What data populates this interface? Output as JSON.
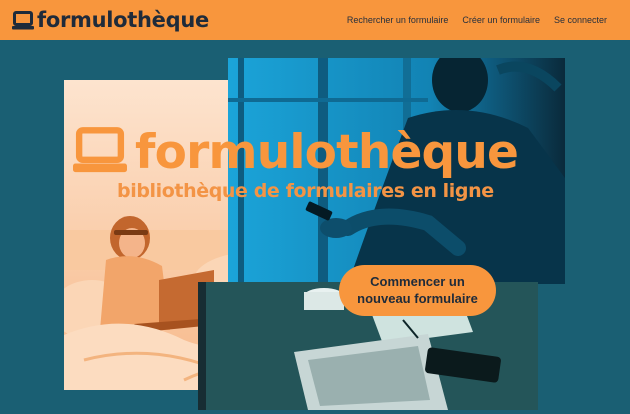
{
  "header": {
    "brand_name": "formulothèque",
    "nav": [
      {
        "label": "Rechercher un formulaire"
      },
      {
        "label": "Créer un formulaire"
      },
      {
        "label": "Se connecter"
      }
    ]
  },
  "hero": {
    "title": "formulothèque",
    "subtitle": "bibliothèque de formulaires en ligne",
    "cta_label": "Commencer un nouveau formulaire"
  },
  "icons": {
    "brand": "laptop-icon",
    "hero": "laptop-icon"
  },
  "colors": {
    "accent": "#f8963d",
    "background": "#1a5f73",
    "text_dark": "#1f2b3a",
    "photo_tint_blue": "#1fa3d8",
    "photo_tint_orange": "#f9b47a"
  }
}
